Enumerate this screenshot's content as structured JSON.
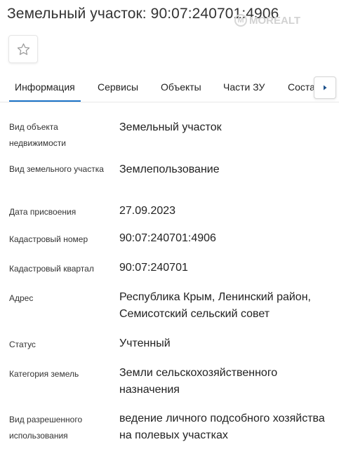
{
  "header": {
    "title": "Земельный участок: 90:07:240701:4906",
    "watermark_text": "MOREALT",
    "watermark_logo": "M"
  },
  "favorite": {
    "icon": "star-icon"
  },
  "tabs": [
    {
      "label": "Информация",
      "active": true
    },
    {
      "label": "Сервисы"
    },
    {
      "label": "Объекты"
    },
    {
      "label": "Части ЗУ"
    },
    {
      "label": "Соста"
    }
  ],
  "tabs_scroll": {
    "icon": "chevron-right-icon"
  },
  "colors": {
    "accent": "#1a73c7",
    "text": "#222222",
    "border": "#e8e8e8"
  },
  "info": {
    "object_type": {
      "label": "Вид объекта недвижимости",
      "value": "Земельный участок"
    },
    "land_type": {
      "label": "Вид земельного участка",
      "value": "Землепользование"
    },
    "assigned_date": {
      "label": "Дата присвоения",
      "value": "27.09.2023"
    },
    "cadastral_number": {
      "label": "Кадастровый номер",
      "value": "90:07:240701:4906"
    },
    "cadastral_quarter": {
      "label": "Кадастровый квартал",
      "value": "90:07:240701"
    },
    "address": {
      "label": "Адрес",
      "value": "Республика Крым, Ленинский район, Семисотский сельский совет"
    },
    "status": {
      "label": "Статус",
      "value": "Учтенный"
    },
    "land_category": {
      "label": "Категория земель",
      "value": "Земли сельскохозяйственного назначения"
    },
    "permitted_use": {
      "label": "Вид разрешенного использования",
      "value": "ведение личного подсобного хозяйства на полевых участках"
    }
  }
}
